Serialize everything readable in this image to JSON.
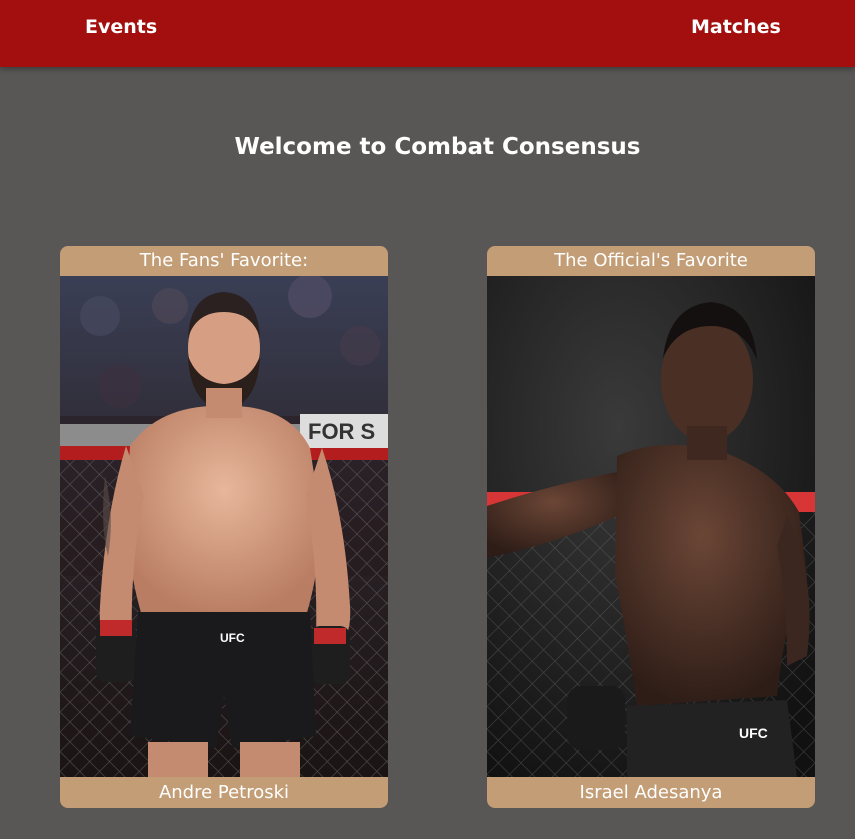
{
  "nav": {
    "events_label": "Events",
    "matches_label": "Matches"
  },
  "page": {
    "title": "Welcome to Combat Consensus"
  },
  "cards": [
    {
      "header": "The Fans' Favorite:",
      "name": "Andre Petroski",
      "banner_text": "FOR S",
      "shorts_logo": "UFC"
    },
    {
      "header": "The Official's Favorite",
      "name": "Israel Adesanya",
      "banner_text": "",
      "shorts_logo": "UFC"
    }
  ],
  "colors": {
    "navbar": "#a30e0e",
    "background": "#585756",
    "card_accent": "#c29d75",
    "text": "#ffffff"
  }
}
